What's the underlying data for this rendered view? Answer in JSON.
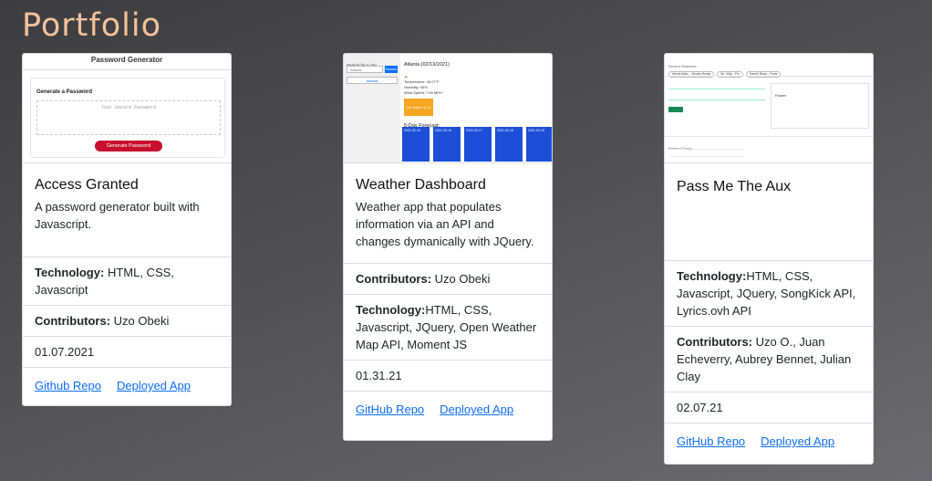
{
  "page": {
    "title": "Portfolio"
  },
  "cards": [
    {
      "preview": {
        "header": "Password Generator",
        "heading": "Generate a Password",
        "placeholder": "Your Secure Password",
        "button": "Generate Password"
      },
      "title": "Access Granted",
      "description": "A password generator built with Javascript.",
      "rows": [
        {
          "label": "Technology:",
          "value": "HTML, CSS, Javascript"
        },
        {
          "label": "Contributors:",
          "value": "Uzo Obeki"
        },
        {
          "label": "",
          "value": "01.07.2021"
        }
      ],
      "links": [
        "Github Repo",
        "Deployed App"
      ]
    },
    {
      "preview": {
        "search_label": "Search for a city:",
        "search_value": "Atlanta",
        "search_button": "Search",
        "history_item": "Atlanta",
        "city": "Atlanta (02/13/2021)",
        "temp": "Temperature: 45.07°F",
        "humidity": "Humidity: 93%",
        "wind": "Wind Speed: 7.65 MPH",
        "uv": "UV Index: 0.11",
        "forecast_title": "5-Day Forecast:",
        "forecast_days": [
          "2021-02-15",
          "2021-02-16",
          "2021-02-17",
          "2021-02-18",
          "2021-02-19"
        ]
      },
      "title": "Weather Dashboard",
      "description": "Weather app that populates information via an API and changes dymanically with JQuery.",
      "rows": [
        {
          "label": "Contributors:",
          "value": " Uzo Obeki"
        },
        {
          "label": "Technology:",
          "value": "HTML, CSS, Javascript, JQuery, Open Weather Map API, Moment JS"
        },
        {
          "label": "",
          "value": "01.31.21"
        }
      ],
      "links": [
        "GitHub Repo",
        "Deployed App"
      ]
    },
    {
      "preview": {
        "recent_label": "Recent Searches",
        "chips": [
          "Alexis Blain - Smoke Break",
          "Mr. Kitty - Fin",
          "Daniel Black - Paris"
        ],
        "lyrics_title": "Flower",
        "related_label": "Related Songs"
      },
      "title": "Pass Me The Aux",
      "description": "",
      "rows": [
        {
          "label": "Technology:",
          "value": "HTML, CSS, Javascript, JQuery, SongKick API, Lyrics.ovh API"
        },
        {
          "label": "Contributors:",
          "value": " Uzo O., Juan Echeverry, Aubrey Bennet, Julian Clay"
        },
        {
          "label": "",
          "value": "02.07.21"
        }
      ],
      "links": [
        "GitHub Repo",
        "Deployed App"
      ]
    }
  ]
}
